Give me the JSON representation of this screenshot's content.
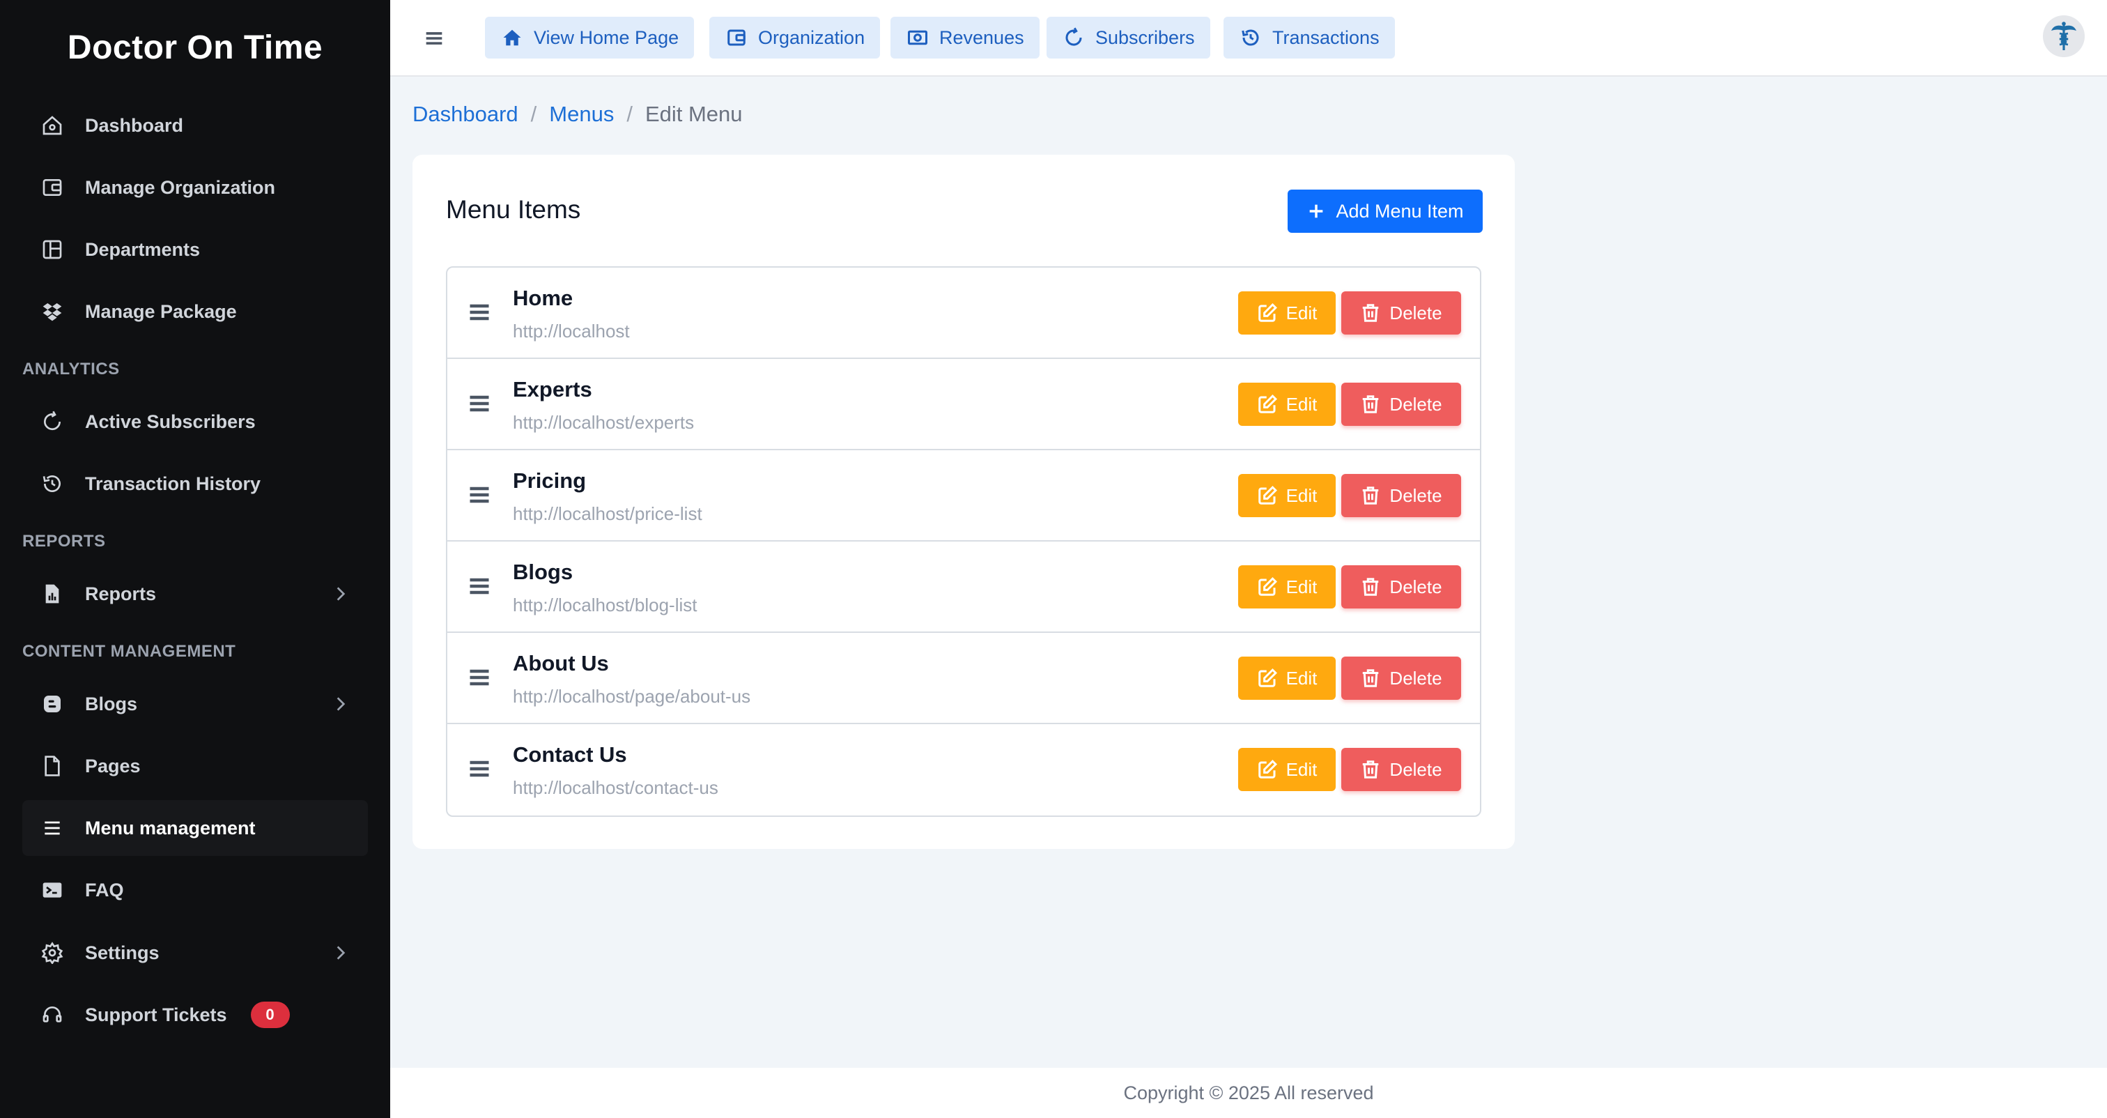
{
  "app": {
    "brand": "Doctor On Time"
  },
  "sidebar": {
    "items": [
      {
        "label": "Dashboard",
        "icon": "home-icon"
      },
      {
        "label": "Manage Organization",
        "icon": "wallet-icon"
      },
      {
        "label": "Departments",
        "icon": "layout-icon"
      },
      {
        "label": "Manage Package",
        "icon": "dropbox-icon"
      },
      {
        "label": "Active Subscribers",
        "icon": "refresh-icon"
      },
      {
        "label": "Transaction History",
        "icon": "history-icon"
      },
      {
        "label": "Reports",
        "icon": "report-icon"
      },
      {
        "label": "Blogs",
        "icon": "blogger-icon"
      },
      {
        "label": "Pages",
        "icon": "file-icon"
      },
      {
        "label": "Menu management",
        "icon": "list-icon"
      },
      {
        "label": "FAQ",
        "icon": "terminal-icon"
      },
      {
        "label": "Settings",
        "icon": "gear-icon"
      },
      {
        "label": "Support Tickets",
        "icon": "headset-icon"
      }
    ],
    "sections": {
      "analytics": "ANALYTICS",
      "reports": "REPORTS",
      "content": "CONTENT MANAGEMENT"
    },
    "support_badge": "0",
    "active_item": "Menu management"
  },
  "topbar": {
    "buttons": [
      {
        "label": "View Home Page",
        "icon": "home-icon"
      },
      {
        "label": "Organization",
        "icon": "wallet-icon"
      },
      {
        "label": "Revenues",
        "icon": "cash-icon"
      },
      {
        "label": "Subscribers",
        "icon": "refresh-icon"
      },
      {
        "label": "Transactions",
        "icon": "history-icon"
      }
    ],
    "avatar_icon": "caduceus-icon"
  },
  "breadcrumb": {
    "items": [
      "Dashboard",
      "Menus"
    ],
    "current": "Edit Menu",
    "separator": "/"
  },
  "card": {
    "title": "Menu Items",
    "add_button": "Add Menu Item",
    "edit_label": "Edit",
    "delete_label": "Delete",
    "items": [
      {
        "title": "Home",
        "url": "http://localhost"
      },
      {
        "title": "Experts",
        "url": "http://localhost/experts"
      },
      {
        "title": "Pricing",
        "url": "http://localhost/price-list"
      },
      {
        "title": "Blogs",
        "url": "http://localhost/blog-list"
      },
      {
        "title": "About Us",
        "url": "http://localhost/page/about-us"
      },
      {
        "title": "Contact Us",
        "url": "http://localhost/contact-us"
      }
    ]
  },
  "footer": {
    "text": "Copyright © 2025 All reserved"
  },
  "colors": {
    "sidebar_bg": "#0f1012",
    "primary": "#0d6efd",
    "edit": "#ffa90f",
    "delete": "#ef5d5d",
    "badge": "#dc2f3d"
  }
}
